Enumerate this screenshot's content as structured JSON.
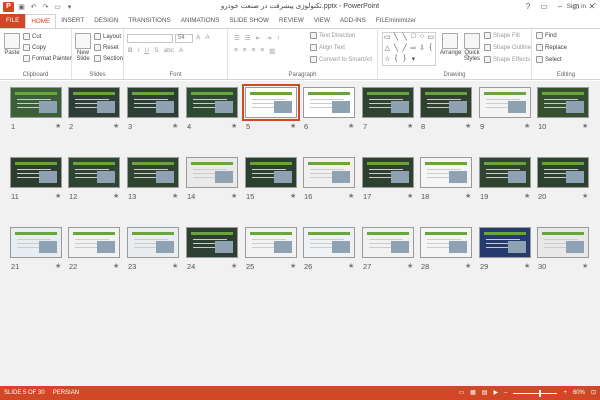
{
  "window": {
    "title": "تکنولوژی پیشرفت در صنعت خودرو.pptx - PowerPoint",
    "app_logo": "P",
    "controls": [
      "?",
      "▭",
      "–",
      "□",
      "✕"
    ]
  },
  "qat": {
    "icons": [
      "save-icon",
      "undo-icon",
      "redo-icon",
      "slideshow-icon",
      "customize-icon"
    ]
  },
  "tabs": [
    {
      "label": "FILE",
      "kind": "file"
    },
    {
      "label": "HOME",
      "kind": "active"
    },
    {
      "label": "INSERT"
    },
    {
      "label": "DESIGN"
    },
    {
      "label": "TRANSITIONS"
    },
    {
      "label": "ANIMATIONS"
    },
    {
      "label": "SLIDE SHOW"
    },
    {
      "label": "REVIEW"
    },
    {
      "label": "VIEW"
    },
    {
      "label": "ADD-INS"
    },
    {
      "label": "FILEminimizer"
    }
  ],
  "account": {
    "signin": "Sign in"
  },
  "ribbon": {
    "clipboard": {
      "paste": "Paste",
      "cut": "Cut",
      "copy": "Copy",
      "format_painter": "Format Painter",
      "label": "Clipboard"
    },
    "slides": {
      "new_slide": "New Slide",
      "layout": "Layout",
      "reset": "Reset",
      "section": "Section",
      "label": "Slides"
    },
    "font": {
      "size": "54",
      "label": "Font"
    },
    "paragraph": {
      "text_direction": "Text Direction",
      "align_text": "Align Text",
      "convert_smartart": "Convert to SmartArt",
      "label": "Paragraph"
    },
    "drawing": {
      "arrange": "Arrange",
      "quick_styles": "Quick Styles",
      "shape_fill": "Shape Fill",
      "shape_outline": "Shape Outline",
      "shape_effects": "Shape Effects",
      "label": "Drawing"
    },
    "editing": {
      "find": "Find",
      "replace": "Replace",
      "select": "Select",
      "label": "Editing"
    }
  },
  "slides": [
    {
      "n": "1",
      "bg": "#3b5f38"
    },
    {
      "n": "2",
      "bg": "#2e3f3a"
    },
    {
      "n": "3",
      "bg": "#2c3f34"
    },
    {
      "n": "4",
      "bg": "#2e4a33"
    },
    {
      "n": "5",
      "bg": "#ffffff",
      "selected": true
    },
    {
      "n": "6",
      "bg": "#ffffff"
    },
    {
      "n": "7",
      "bg": "#2f4430"
    },
    {
      "n": "8",
      "bg": "#30422f"
    },
    {
      "n": "9",
      "bg": "#f4f4f4"
    },
    {
      "n": "10",
      "bg": "#34502f"
    },
    {
      "n": "11",
      "bg": "#2c3d30"
    },
    {
      "n": "12",
      "bg": "#2f4534"
    },
    {
      "n": "13",
      "bg": "#30452f"
    },
    {
      "n": "14",
      "bg": "#eaeaea"
    },
    {
      "n": "15",
      "bg": "#2c4030"
    },
    {
      "n": "16",
      "bg": "#f0f0f0"
    },
    {
      "n": "17",
      "bg": "#2e402f"
    },
    {
      "n": "18",
      "bg": "#f5f5f5"
    },
    {
      "n": "19",
      "bg": "#30442f"
    },
    {
      "n": "20",
      "bg": "#2d4130"
    },
    {
      "n": "21",
      "bg": "#e6eef2"
    },
    {
      "n": "22",
      "bg": "#f2f2f2"
    },
    {
      "n": "23",
      "bg": "#e9edf0"
    },
    {
      "n": "24",
      "bg": "#2c3f30"
    },
    {
      "n": "25",
      "bg": "#f3f3f3"
    },
    {
      "n": "26",
      "bg": "#eef2f4"
    },
    {
      "n": "27",
      "bg": "#f1f1f1"
    },
    {
      "n": "28",
      "bg": "#f5f5f5"
    },
    {
      "n": "29",
      "bg": "#263a6e"
    },
    {
      "n": "30",
      "bg": "#e8e8e8"
    }
  ],
  "star": "★",
  "status": {
    "slide_info": "SLIDE 5 OF 30",
    "language": "PERSIAN",
    "zoom": "60%",
    "zoom_fraction": 0.6
  },
  "colors": {
    "accent": "#d24726",
    "sorter_bg": "#f1f1f1"
  }
}
